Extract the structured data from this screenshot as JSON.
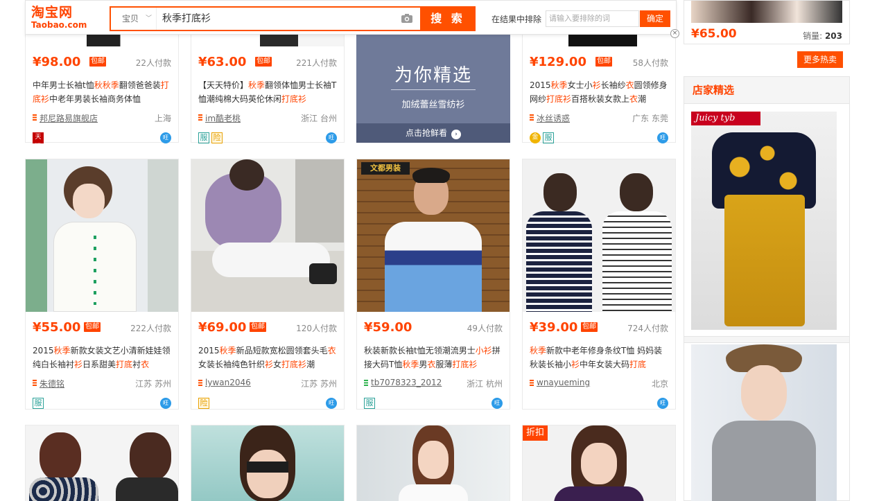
{
  "search": {
    "logo_cn": "淘宝网",
    "logo_en": "Taobao.com",
    "scope": "宝贝",
    "query": "秋季打底衫",
    "button": "搜 索",
    "exclude_label": "在结果中排除",
    "exclude_placeholder": "请输入要排除的词",
    "exclude_button": "确定",
    "close": "×"
  },
  "colors": {
    "accent": "#ff5000",
    "price": "#ff4400",
    "ad_bg": "#6f7a99"
  },
  "products": [
    {
      "price": "¥98.00",
      "baoyou": "包邮",
      "deals": "22人付款",
      "title_parts": [
        "中年男士长袖t恤",
        "秋秋季",
        "翻领爸爸装",
        "打底衫",
        "中老年男装长袖商务体恤"
      ],
      "shop": "邦尼路易旗舰店",
      "location": "上海",
      "badges": [
        "tm"
      ]
    },
    {
      "price": "¥63.00",
      "baoyou": "包邮",
      "deals": "221人付款",
      "title_parts": [
        "【天天特价】",
        "秋季",
        "翻领体恤男士长袖T恤潮纯棉大码英伦休闲",
        "打底衫",
        ""
      ],
      "shop": "im酷老桃",
      "location": "浙江 台州",
      "badges": [
        "fu",
        "xian"
      ]
    },
    {
      "price": "¥129.00",
      "baoyou": "包邮",
      "deals": "58人付款",
      "title_parts": [
        "2015",
        "秋季",
        "女士小",
        "衫",
        "长袖纱",
        "衣",
        "圆领修身网纱",
        "打底衫",
        "百搭秋装女款上",
        "衣",
        "潮"
      ],
      "shop": "冰丝诱惑",
      "location": "广东 东莞",
      "badges": [
        "gold",
        "fu"
      ]
    },
    {
      "price": "¥55.00",
      "baoyou": "包邮",
      "deals": "222人付款",
      "title_parts": [
        "2015",
        "秋季",
        "新款女装文艺小清新娃娃领纯白长袖衬",
        "衫",
        "日系甜美",
        "打底",
        "衬",
        "衣",
        ""
      ],
      "shop": "朱德铭",
      "location": "江苏 苏州",
      "badges": [
        "fu"
      ]
    },
    {
      "price": "¥69.00",
      "baoyou": "包邮",
      "deals": "120人付款",
      "title_parts": [
        "2015",
        "秋季",
        "新品短款宽松圆领套头毛",
        "衣",
        "女装长袖纯色针织",
        "衫",
        "女",
        "打底衫",
        "潮"
      ],
      "shop": "lywan2046",
      "location": "江苏 苏州",
      "badges": [
        "xian"
      ]
    },
    {
      "price": "¥59.00",
      "baoyou": "",
      "deals": "49人付款",
      "title_parts": [
        "秋装新款长袖t恤无领潮流男士",
        "小衫",
        "拼接大码T恤",
        "秋季",
        "男",
        "衣",
        "服薄",
        "打底衫",
        ""
      ],
      "shop": "tb7078323_2012",
      "location": "浙江 杭州",
      "badges": [
        "fu"
      ]
    },
    {
      "price": "¥39.00",
      "baoyou": "包邮",
      "deals": "724人付款",
      "title_parts": [
        "",
        "秋季",
        "新款中老年修身条纹T恤 妈妈装秋装长袖小",
        "衫",
        "中年女装大码",
        "打底",
        ""
      ],
      "shop": "wnayueming",
      "location": "北京",
      "badges": []
    }
  ],
  "ad": {
    "headline": "为你精选",
    "sub": "加绒蕾丝雪纺衫",
    "cta": "点击抢鲜看",
    "cta_arrow": "›"
  },
  "badge_text": {
    "fu": "服",
    "xian": "险",
    "tm": "天猫",
    "gold": "金"
  },
  "ww_text": "旺",
  "right": {
    "top_price": "¥65.00",
    "sales_label": "销量:",
    "sales_value": "203",
    "more_button": "更多热卖",
    "panel_title": "店家精选",
    "brand_tag": "Juicy tyb"
  },
  "bottom": {
    "zhekou": "折扣"
  },
  "overlay_texts": {
    "img7_tag": "文都男装"
  }
}
